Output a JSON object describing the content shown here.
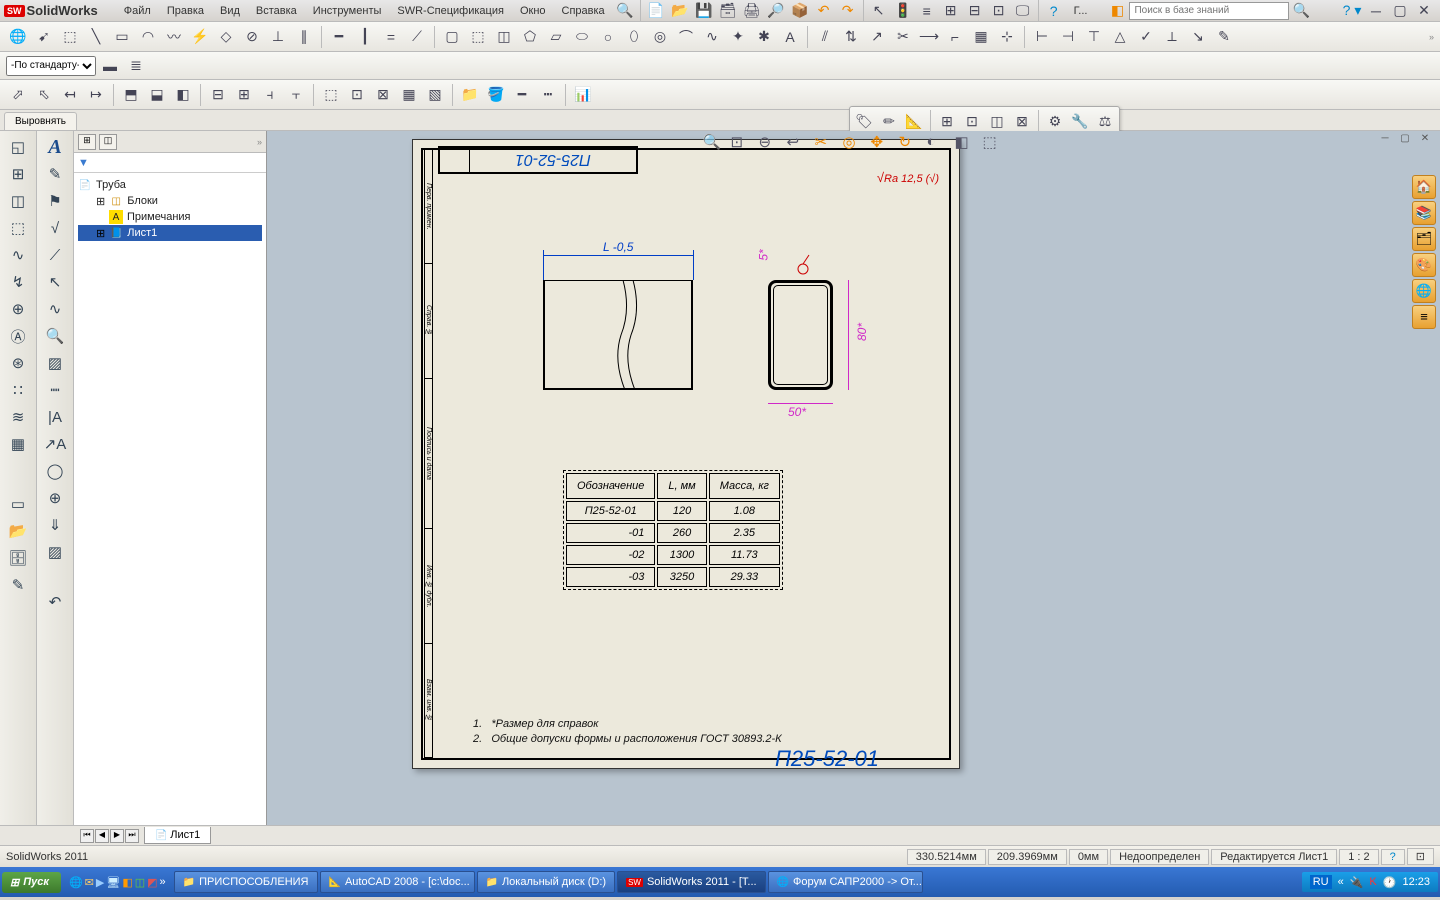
{
  "app": {
    "name": "SolidWorks",
    "status_name": "SolidWorks 2011"
  },
  "menu": [
    "Файл",
    "Правка",
    "Вид",
    "Вставка",
    "Инструменты",
    "SWR-Спецификация",
    "Окно",
    "Справка"
  ],
  "search": {
    "placeholder": "Поиск в базе знаний"
  },
  "standard_combo": "-По стандарту-",
  "tab": "Выровнять",
  "tree": {
    "root": "Труба",
    "n1": "Блоки",
    "n2": "Примечания",
    "n3": "Лист1"
  },
  "drawing": {
    "title_rev": "П25-52-01",
    "ra": "Ra 12,5 (√)",
    "dim_L": "L -0,5",
    "dim_5": "5*",
    "dim_80": "80*",
    "dim_50": "50*",
    "side_labels": [
      "Перв. примен.",
      "Справ. №",
      "Подпись и дата",
      "Инв. № дубл.",
      "Взам. инв. №"
    ],
    "table": {
      "h1": "Обозначение",
      "h2": "L, мм",
      "h3": "Масса, кг",
      "rows": [
        {
          "a": "П25-52-01",
          "b": "120",
          "c": "1.08"
        },
        {
          "a": "-01",
          "b": "260",
          "c": "2.35"
        },
        {
          "a": "-02",
          "b": "1300",
          "c": "11.73"
        },
        {
          "a": "-03",
          "b": "3250",
          "c": "29.33"
        }
      ]
    },
    "note1_num": "1.",
    "note1": "*Размер для справок",
    "note2_num": "2.",
    "note2": "Общие допуски формы и расположения ГОСТ 30893.2-К",
    "footer_partial": "П25-52-01"
  },
  "sheet_tab": "Лист1",
  "status": {
    "x": "330.5214мм",
    "y": "209.3969мм",
    "z": "0мм",
    "s1": "Недоопределен",
    "s2": "Редактируется Лист1",
    "s3": "1 : 2"
  },
  "taskbar": {
    "start": "Пуск",
    "tasks": [
      "ПРИСПОСОБЛЕНИЯ",
      "AutoCAD 2008 - [c:\\doc...",
      "Локальный диск (D:)",
      "SolidWorks 2011 - [T...",
      "Форум САПР2000 -> От..."
    ],
    "lang": "RU",
    "time": "12:23"
  }
}
